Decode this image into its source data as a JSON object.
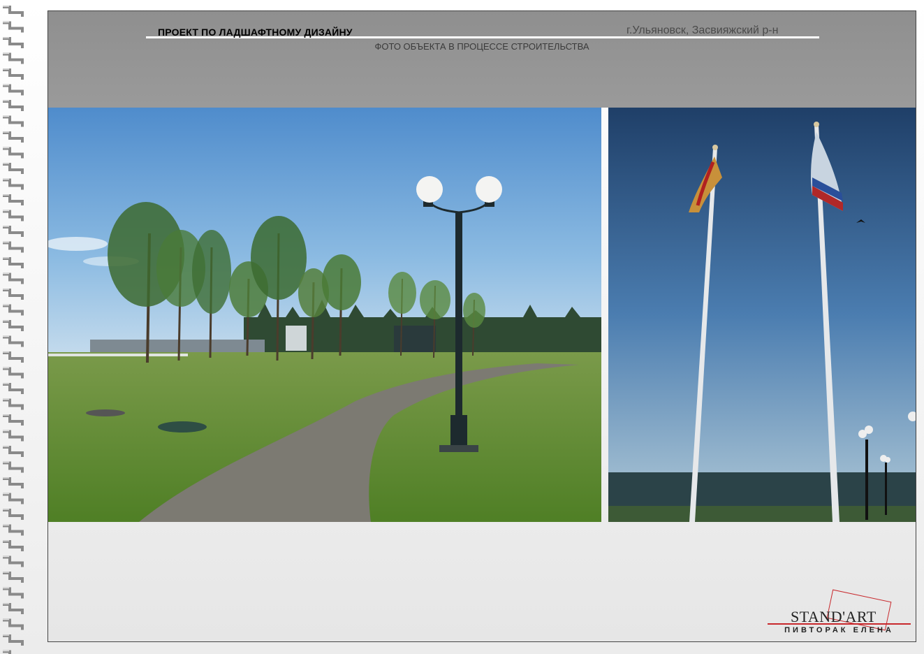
{
  "header": {
    "title": "ПРОЕКТ ПО ЛАДШАФТНОМУ ДИЗАЙНУ",
    "location": "г.Ульяновск, Засвияжский р-н",
    "subtitle": "ФОТО ОБЪЕКТА В ПРОЦЕССЕ СТРОИТЕЛЬСТВА"
  },
  "logo": {
    "name": "STAND'ART",
    "author": "ПИВТОРАК ЕЛЕНА"
  },
  "colors": {
    "header_band": "#959595",
    "logo_accent": "#c8282c",
    "sky": "#5e9bd0",
    "grass": "#5d8a2e"
  }
}
